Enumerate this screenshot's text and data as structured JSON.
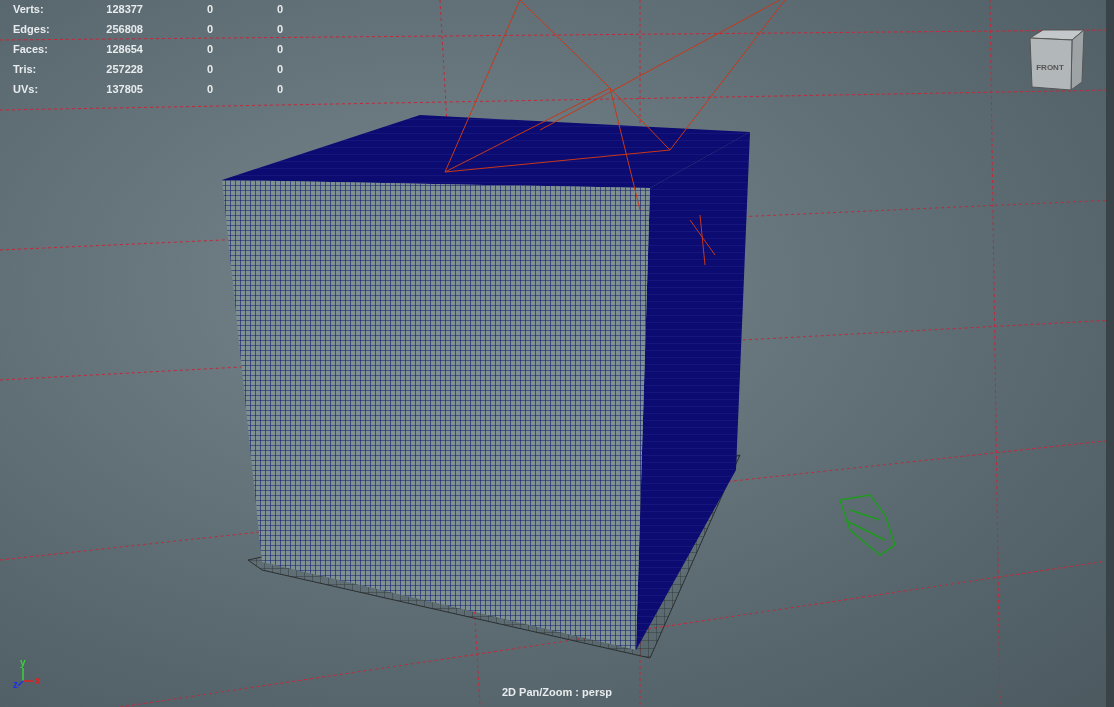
{
  "hud": {
    "rows": [
      {
        "label": "Verts:",
        "values": [
          "128377",
          "0",
          "0"
        ]
      },
      {
        "label": "Edges:",
        "values": [
          "256808",
          "0",
          "0"
        ]
      },
      {
        "label": "Faces:",
        "values": [
          "128654",
          "0",
          "0"
        ]
      },
      {
        "label": "Tris:",
        "values": [
          "257228",
          "0",
          "0"
        ]
      },
      {
        "label": "UVs:",
        "values": [
          "137805",
          "0",
          "0"
        ]
      }
    ]
  },
  "view_cube": {
    "label": "FRONT"
  },
  "axis": {
    "x": "x",
    "y": "y",
    "z": "z"
  },
  "status": "2D Pan/Zoom : persp"
}
